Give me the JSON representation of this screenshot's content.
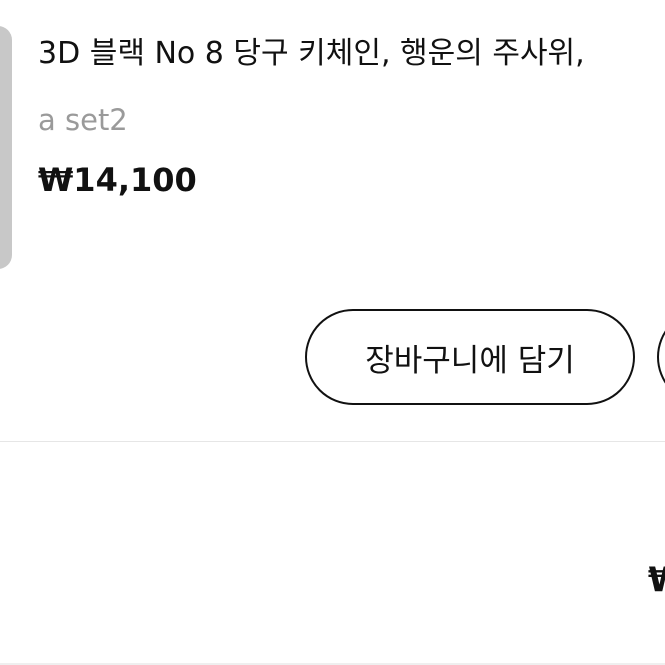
{
  "product": {
    "title": "3D 블랙 No 8 당구 키체인, 행운의 주사위,",
    "option": "a set2",
    "price": "₩14,100"
  },
  "actions": {
    "add_to_cart_label": "장바구니에 담기"
  },
  "summary": {
    "total_currency_fragment": "₩"
  }
}
